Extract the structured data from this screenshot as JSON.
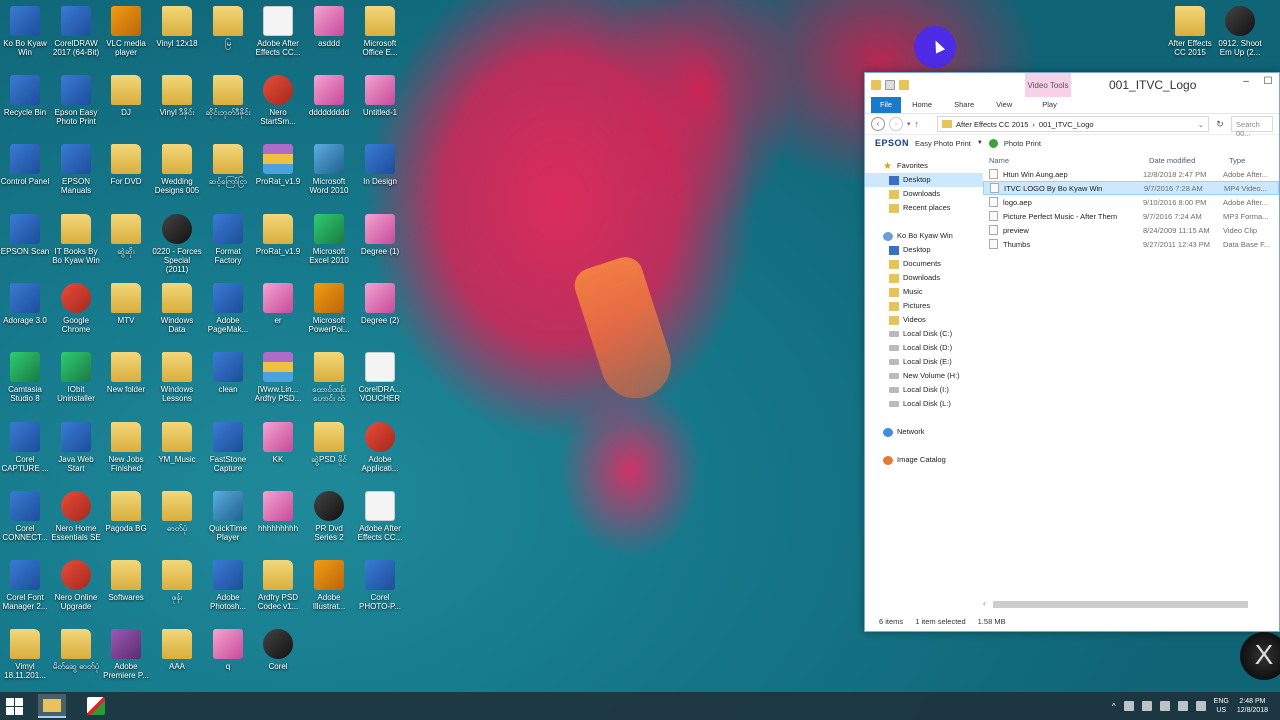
{
  "desktop_icons": [
    {
      "label": "Ko Bo Kyaw Win",
      "icon": "user-computer-icon"
    },
    {
      "label": "CorelDRAW 2017 (64-Bit)",
      "icon": "coreldraw-icon"
    },
    {
      "label": "VLC media player",
      "icon": "vlc-icon"
    },
    {
      "label": "Vinyl 12x18",
      "icon": "folder-icon"
    },
    {
      "label": "မြ",
      "icon": "folder-icon"
    },
    {
      "label": "Adobe After Effects CC...",
      "icon": "document-icon"
    },
    {
      "label": "asddd",
      "icon": "image-icon"
    },
    {
      "label": "Microsoft Office E...",
      "icon": "folder-icon"
    },
    {
      "label": "Recycle Bin",
      "icon": "recycle-bin-icon"
    },
    {
      "label": "Epson Easy Photo Print",
      "icon": "epson-icon"
    },
    {
      "label": "DJ",
      "icon": "folder-icon"
    },
    {
      "label": "Vinyl ဒီဇိုင်း",
      "icon": "folder-icon"
    },
    {
      "label": "ဆိုင်းဘုတ်ဒီဇိုင်း",
      "icon": "folder-icon"
    },
    {
      "label": "Nero StartSm...",
      "icon": "nero-icon"
    },
    {
      "label": "ddddddddd",
      "icon": "image-icon"
    },
    {
      "label": "Untitled-1",
      "icon": "image-icon"
    },
    {
      "label": "Control Panel",
      "icon": "control-panel-icon"
    },
    {
      "label": "EPSON Manuals",
      "icon": "epson-icon"
    },
    {
      "label": "For DVD",
      "icon": "folder-icon"
    },
    {
      "label": "Wedding Designs 005",
      "icon": "folder-icon"
    },
    {
      "label": "ဆင့်ကြော်ငြာ",
      "icon": "folder-icon"
    },
    {
      "label": "ProRat_v1.9",
      "icon": "winrar-icon"
    },
    {
      "label": "Microsoft Word 2010",
      "icon": "word-icon"
    },
    {
      "label": "In Design",
      "icon": "indesign-icon"
    },
    {
      "label": "EPSON Scan",
      "icon": "epson-scan-icon"
    },
    {
      "label": "IT Books By Bo Kyaw Win",
      "icon": "folder-icon"
    },
    {
      "label": "ဆွဲဆိုး",
      "icon": "folder-icon"
    },
    {
      "label": "0220 - Forces Special (2011)",
      "icon": "video-icon"
    },
    {
      "label": "Format Factory",
      "icon": "format-factory-icon"
    },
    {
      "label": "ProRat_v1.9",
      "icon": "folder-icon"
    },
    {
      "label": "Microsoft Excel 2010",
      "icon": "excel-icon"
    },
    {
      "label": "Degree (1)",
      "icon": "image-icon"
    },
    {
      "label": "Adorage 3.0",
      "icon": "adorage-icon"
    },
    {
      "label": "Google Chrome",
      "icon": "chrome-icon"
    },
    {
      "label": "MTV",
      "icon": "folder-icon"
    },
    {
      "label": "Windows Data",
      "icon": "folder-icon"
    },
    {
      "label": "Adobe PageMak...",
      "icon": "pagemaker-icon"
    },
    {
      "label": "er",
      "icon": "image-icon"
    },
    {
      "label": "Microsoft PowerPoi...",
      "icon": "powerpoint-icon"
    },
    {
      "label": "Degree (2)",
      "icon": "image-icon"
    },
    {
      "label": "Camtasia Studio 8",
      "icon": "camtasia-icon"
    },
    {
      "label": "IObit Uninstaller",
      "icon": "iobit-icon"
    },
    {
      "label": "New folder",
      "icon": "folder-icon"
    },
    {
      "label": "Windows Lessons",
      "icon": "folder-icon"
    },
    {
      "label": "clean",
      "icon": "app-icon"
    },
    {
      "label": "[Www.Lin... Ardfry PSD...",
      "icon": "winrar-icon"
    },
    {
      "label": "ထောင်ထန်း ဟောင်း ထံ",
      "icon": "folder-icon"
    },
    {
      "label": "CorelDRA... VOUCHER",
      "icon": "document-icon"
    },
    {
      "label": "Corel CAPTURE ...",
      "icon": "corel-capture-icon"
    },
    {
      "label": "Java Web Start",
      "icon": "java-icon"
    },
    {
      "label": "New Jobs Finished",
      "icon": "folder-icon"
    },
    {
      "label": "YM_Music",
      "icon": "folder-icon"
    },
    {
      "label": "FastStone Capture",
      "icon": "faststone-icon"
    },
    {
      "label": "KK",
      "icon": "image-icon"
    },
    {
      "label": "ဆွဲPSD ဖိုင်",
      "icon": "folder-icon"
    },
    {
      "label": "Adobe Applicati...",
      "icon": "adobe-icon"
    },
    {
      "label": "Corel CONNECT...",
      "icon": "corel-connect-icon"
    },
    {
      "label": "Nero Home Essentials SE",
      "icon": "nero-icon"
    },
    {
      "label": "Pagoda BG",
      "icon": "folder-icon"
    },
    {
      "label": "ဓာတ်ပုံ",
      "icon": "folder-icon"
    },
    {
      "label": "QuickTime Player",
      "icon": "quicktime-icon"
    },
    {
      "label": "hhhhhhhhh",
      "icon": "image-icon"
    },
    {
      "label": "PR Dvd Series 2",
      "icon": "disc-icon"
    },
    {
      "label": "Adobe After Effects CC...",
      "icon": "document-icon"
    },
    {
      "label": "Corel Font Manager 2...",
      "icon": "corel-font-icon"
    },
    {
      "label": "Nero Online Upgrade",
      "icon": "nero-icon"
    },
    {
      "label": "Softwares",
      "icon": "folder-icon"
    },
    {
      "label": "ဖုန်း",
      "icon": "folder-icon"
    },
    {
      "label": "Adobe Photosh...",
      "icon": "photoshop-icon"
    },
    {
      "label": "Ardfry PSD Codec v1...",
      "icon": "folder-icon"
    },
    {
      "label": "Adobe Illustrat...",
      "icon": "illustrator-icon"
    },
    {
      "label": "Corel PHOTO-P...",
      "icon": "corel-photo-icon"
    },
    {
      "label": "Vimyl 18.11.201...",
      "icon": "folder-icon"
    },
    {
      "label": "မိတ်ဆွေ ဓာတ်ပုံ",
      "icon": "folder-icon"
    },
    {
      "label": "Adobe Premiere P...",
      "icon": "premiere-icon"
    },
    {
      "label": "AAA",
      "icon": "folder-icon"
    },
    {
      "label": "q",
      "icon": "image-icon"
    },
    {
      "label": "Corel",
      "icon": "corel-icon"
    },
    {
      "label": "After Effects CC 2015",
      "icon": "folder-icon"
    },
    {
      "label": "0912. Shoot Em Up (2...",
      "icon": "video-icon"
    }
  ],
  "explorer": {
    "title": "001_ITVC_Logo",
    "contextual_tab": "Video Tools",
    "ribbon_tabs": [
      "File",
      "Home",
      "Share",
      "View",
      "Play"
    ],
    "address": {
      "crumb1": "After Effects CC 2015",
      "sep": "›",
      "crumb2": "001_ITVC_Logo"
    },
    "search_placeholder": "Search 00...",
    "toolbar": {
      "epson": "EPSON",
      "easy_photo": "Easy Photo Print",
      "photo_print": "Photo Print"
    },
    "nav": {
      "favorites": "Favorites",
      "fav_items": [
        "Desktop",
        "Downloads",
        "Recent places"
      ],
      "user": "Ko Bo Kyaw Win",
      "user_items": [
        "Desktop",
        "Documents",
        "Downloads",
        "Music",
        "Pictures",
        "Videos",
        "Local Disk (C:)",
        "Local Disk (D:)",
        "Local Disk (E:)",
        "New Volume (H:)",
        "Local Disk (I:)",
        "Local Disk (L:)"
      ],
      "network": "Network",
      "image_catalog": "Image Catalog"
    },
    "columns": {
      "name": "Name",
      "date": "Date modified",
      "type": "Type"
    },
    "files": [
      {
        "name": "Htun Win Aung.aep",
        "date": "12/8/2018 2:47 PM",
        "type": "Adobe After..."
      },
      {
        "name": "ITVC LOGO By Bo Kyaw Win",
        "date": "9/7/2016 7:28 AM",
        "type": "MP4 Video..."
      },
      {
        "name": "logo.aep",
        "date": "9/10/2016 8:00 PM",
        "type": "Adobe After..."
      },
      {
        "name": "Picture Perfect Music - After Them",
        "date": "9/7/2016 7:24 AM",
        "type": "MP3 Forma..."
      },
      {
        "name": "preview",
        "date": "8/24/2009 11:15 AM",
        "type": "Video Clip"
      },
      {
        "name": "Thumbs",
        "date": "9/27/2011 12:43 PM",
        "type": "Data Base F..."
      }
    ],
    "status": {
      "items": "6 items",
      "selected": "1 item selected",
      "size": "1.58 MB"
    }
  },
  "taskbar": {
    "lang_top": "ENG",
    "lang_bottom": "US",
    "time": "2:48 PM",
    "date": "12/8/2018"
  }
}
